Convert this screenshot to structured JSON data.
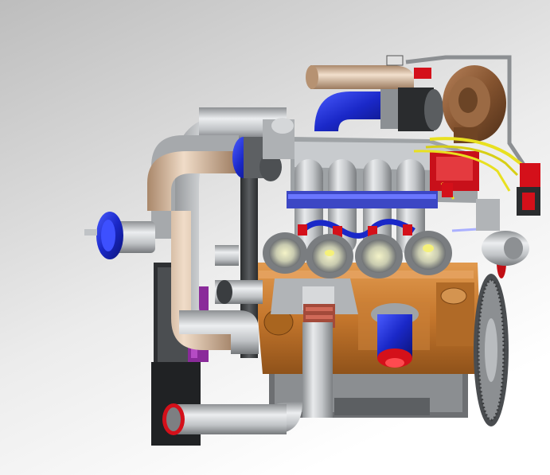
{
  "scene": {
    "subject": "",
    "colors": {
      "background_top": "#c6c6c6",
      "background_bottom": "#ffffff",
      "pipe_silver": "#b9bcbf",
      "pipe_tan": "#d8b89c",
      "engine_block": "#c87a2c",
      "oil_pan": "#6d6f72",
      "intake_plenum": "#8f9396",
      "turbo_housing": "#8a5a35",
      "blue_anodized": "#1f2fd0",
      "red_accent": "#d4101a",
      "yellow_wire": "#e8e020",
      "purple_part": "#8a2b9a",
      "dark_steel": "#3a3d40",
      "flywheel": "#7c7f82"
    }
  }
}
